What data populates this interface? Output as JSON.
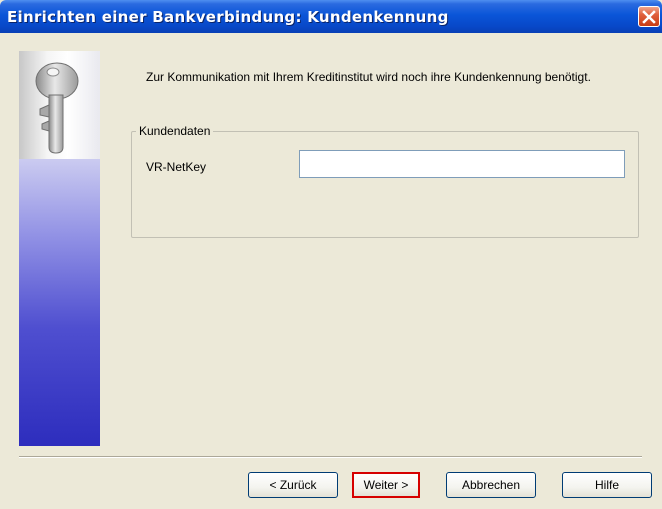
{
  "window": {
    "title": "Einrichten einer Bankverbindung: Kundenkennung",
    "close_icon": "close-icon"
  },
  "sidebar": {
    "icon": "key-icon"
  },
  "intro_text": "Zur Kommunikation mit Ihrem Kreditinstitut wird noch ihre Kundenkennung benötigt.",
  "group": {
    "legend": "Kundendaten",
    "field_label": "VR-NetKey",
    "field_value": ""
  },
  "buttons": {
    "back": "< Zurück",
    "next": "Weiter >",
    "cancel": "Abbrechen",
    "help": "Hilfe"
  },
  "colors": {
    "titlebar": "#0a55d8",
    "highlight": "#d60000",
    "dialog_bg": "#ece9d8"
  }
}
